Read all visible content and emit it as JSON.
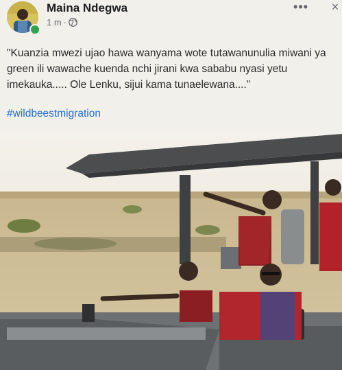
{
  "post": {
    "author": "Maina Ndegwa",
    "time": "1 m",
    "separator": "·",
    "more_icon": "•••",
    "close_icon": "×",
    "text": "\"Kuanzia mwezi ujao hawa wanyama wote tutawanunulia miwani ya green ili wawache kuenda nchi jirani kwa sababu nyasi yetu imekauka..... Ole Lenku, sijui kama tunaelewana....\"",
    "hashtag": "#wildbeestmigration"
  },
  "colors": {
    "accent": "#216fdb",
    "online": "#31a24c",
    "meta": "#65676b"
  },
  "icons": {
    "privacy": "globe-icon",
    "more": "more-options-icon",
    "close": "close-icon",
    "presence": "online-status-dot"
  }
}
